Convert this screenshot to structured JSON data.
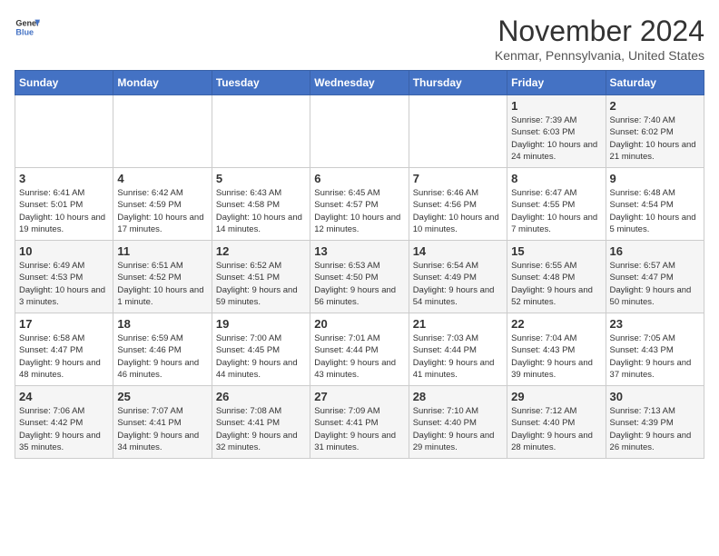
{
  "header": {
    "logo_general": "General",
    "logo_blue": "Blue",
    "title": "November 2024",
    "location": "Kenmar, Pennsylvania, United States"
  },
  "days_of_week": [
    "Sunday",
    "Monday",
    "Tuesday",
    "Wednesday",
    "Thursday",
    "Friday",
    "Saturday"
  ],
  "weeks": [
    [
      {
        "day": "",
        "info": ""
      },
      {
        "day": "",
        "info": ""
      },
      {
        "day": "",
        "info": ""
      },
      {
        "day": "",
        "info": ""
      },
      {
        "day": "",
        "info": ""
      },
      {
        "day": "1",
        "info": "Sunrise: 7:39 AM\nSunset: 6:03 PM\nDaylight: 10 hours and 24 minutes."
      },
      {
        "day": "2",
        "info": "Sunrise: 7:40 AM\nSunset: 6:02 PM\nDaylight: 10 hours and 21 minutes."
      }
    ],
    [
      {
        "day": "3",
        "info": "Sunrise: 6:41 AM\nSunset: 5:01 PM\nDaylight: 10 hours and 19 minutes."
      },
      {
        "day": "4",
        "info": "Sunrise: 6:42 AM\nSunset: 4:59 PM\nDaylight: 10 hours and 17 minutes."
      },
      {
        "day": "5",
        "info": "Sunrise: 6:43 AM\nSunset: 4:58 PM\nDaylight: 10 hours and 14 minutes."
      },
      {
        "day": "6",
        "info": "Sunrise: 6:45 AM\nSunset: 4:57 PM\nDaylight: 10 hours and 12 minutes."
      },
      {
        "day": "7",
        "info": "Sunrise: 6:46 AM\nSunset: 4:56 PM\nDaylight: 10 hours and 10 minutes."
      },
      {
        "day": "8",
        "info": "Sunrise: 6:47 AM\nSunset: 4:55 PM\nDaylight: 10 hours and 7 minutes."
      },
      {
        "day": "9",
        "info": "Sunrise: 6:48 AM\nSunset: 4:54 PM\nDaylight: 10 hours and 5 minutes."
      }
    ],
    [
      {
        "day": "10",
        "info": "Sunrise: 6:49 AM\nSunset: 4:53 PM\nDaylight: 10 hours and 3 minutes."
      },
      {
        "day": "11",
        "info": "Sunrise: 6:51 AM\nSunset: 4:52 PM\nDaylight: 10 hours and 1 minute."
      },
      {
        "day": "12",
        "info": "Sunrise: 6:52 AM\nSunset: 4:51 PM\nDaylight: 9 hours and 59 minutes."
      },
      {
        "day": "13",
        "info": "Sunrise: 6:53 AM\nSunset: 4:50 PM\nDaylight: 9 hours and 56 minutes."
      },
      {
        "day": "14",
        "info": "Sunrise: 6:54 AM\nSunset: 4:49 PM\nDaylight: 9 hours and 54 minutes."
      },
      {
        "day": "15",
        "info": "Sunrise: 6:55 AM\nSunset: 4:48 PM\nDaylight: 9 hours and 52 minutes."
      },
      {
        "day": "16",
        "info": "Sunrise: 6:57 AM\nSunset: 4:47 PM\nDaylight: 9 hours and 50 minutes."
      }
    ],
    [
      {
        "day": "17",
        "info": "Sunrise: 6:58 AM\nSunset: 4:47 PM\nDaylight: 9 hours and 48 minutes."
      },
      {
        "day": "18",
        "info": "Sunrise: 6:59 AM\nSunset: 4:46 PM\nDaylight: 9 hours and 46 minutes."
      },
      {
        "day": "19",
        "info": "Sunrise: 7:00 AM\nSunset: 4:45 PM\nDaylight: 9 hours and 44 minutes."
      },
      {
        "day": "20",
        "info": "Sunrise: 7:01 AM\nSunset: 4:44 PM\nDaylight: 9 hours and 43 minutes."
      },
      {
        "day": "21",
        "info": "Sunrise: 7:03 AM\nSunset: 4:44 PM\nDaylight: 9 hours and 41 minutes."
      },
      {
        "day": "22",
        "info": "Sunrise: 7:04 AM\nSunset: 4:43 PM\nDaylight: 9 hours and 39 minutes."
      },
      {
        "day": "23",
        "info": "Sunrise: 7:05 AM\nSunset: 4:43 PM\nDaylight: 9 hours and 37 minutes."
      }
    ],
    [
      {
        "day": "24",
        "info": "Sunrise: 7:06 AM\nSunset: 4:42 PM\nDaylight: 9 hours and 35 minutes."
      },
      {
        "day": "25",
        "info": "Sunrise: 7:07 AM\nSunset: 4:41 PM\nDaylight: 9 hours and 34 minutes."
      },
      {
        "day": "26",
        "info": "Sunrise: 7:08 AM\nSunset: 4:41 PM\nDaylight: 9 hours and 32 minutes."
      },
      {
        "day": "27",
        "info": "Sunrise: 7:09 AM\nSunset: 4:41 PM\nDaylight: 9 hours and 31 minutes."
      },
      {
        "day": "28",
        "info": "Sunrise: 7:10 AM\nSunset: 4:40 PM\nDaylight: 9 hours and 29 minutes."
      },
      {
        "day": "29",
        "info": "Sunrise: 7:12 AM\nSunset: 4:40 PM\nDaylight: 9 hours and 28 minutes."
      },
      {
        "day": "30",
        "info": "Sunrise: 7:13 AM\nSunset: 4:39 PM\nDaylight: 9 hours and 26 minutes."
      }
    ]
  ]
}
